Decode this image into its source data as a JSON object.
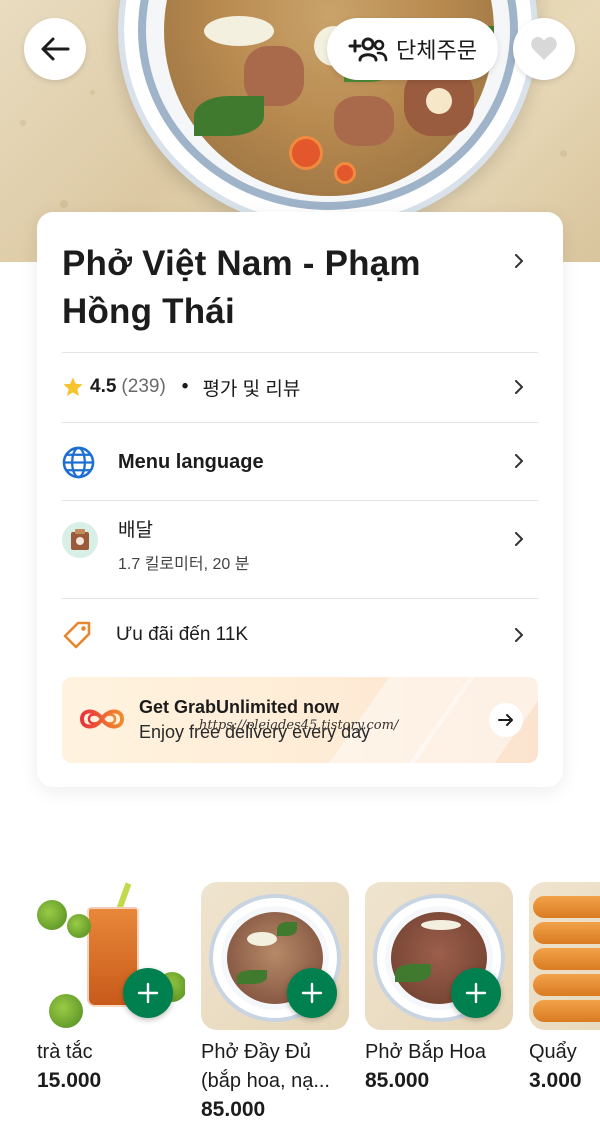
{
  "header": {
    "group_order_label": "단체주문"
  },
  "restaurant": {
    "name": "Phở Việt Nam - Phạm Hồng Thái",
    "rating": "4.5",
    "rating_count": "(239)",
    "reviews_label": "평가 및 리뷰",
    "menu_language_label": "Menu language",
    "delivery": {
      "title": "배달",
      "details": "1.7 킬로미터, 20 분"
    },
    "promo_label": "Ưu đãi đến 11K"
  },
  "banner": {
    "title": "Get GrabUnlimited now",
    "subtitle": "Enjoy free delivery every day",
    "watermark": "https://pleiades45.tistory.com/"
  },
  "menu_items": [
    {
      "name": "trà tắc",
      "price": "15.000"
    },
    {
      "name": "Phở Đầy Đủ (bắp hoa, nạ...",
      "price": "85.000"
    },
    {
      "name": "Phở Bắp Hoa",
      "price": "85.000"
    },
    {
      "name": "Quẩy",
      "price": "3.000"
    }
  ],
  "colors": {
    "grab_green": "#00804f",
    "star_yellow": "#f7c42f",
    "promo_orange": "#e7862c",
    "globe_blue": "#1d6fd1"
  },
  "icons": [
    "back-arrow-icon",
    "add-group-icon",
    "heart-icon",
    "chevron-right-icon",
    "star-icon",
    "globe-icon",
    "delivery-icon",
    "tag-icon",
    "grab-unlimited-logo",
    "arrow-right-icon",
    "plus-icon"
  ]
}
